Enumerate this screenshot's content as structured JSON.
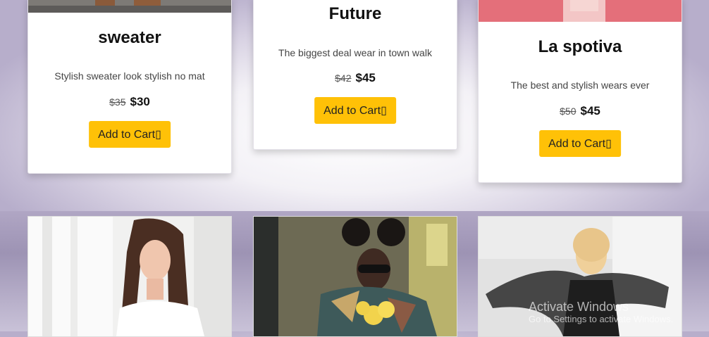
{
  "products": [
    {
      "title": "sweater",
      "stars": "     ",
      "description": "Stylish sweater look stylish no mat",
      "old_price": "$35",
      "price": "$30",
      "button_label": "Add to Cart"
    },
    {
      "title": "Future",
      "stars": "     ",
      "description": "The biggest deal wear in town walk",
      "old_price": "$42",
      "price": "$45",
      "button_label": "Add to Cart"
    },
    {
      "title": "La spotiva",
      "stars": "     ",
      "description": "The best and stylish wears ever",
      "old_price": "$50",
      "price": "$45",
      "button_label": "Add to Cart"
    }
  ],
  "button_icon": "cart-icon",
  "accent_color": "#ffc107",
  "watermark": {
    "line1": "Activate Windows",
    "line2": "Go to Settings to activate Windows."
  }
}
